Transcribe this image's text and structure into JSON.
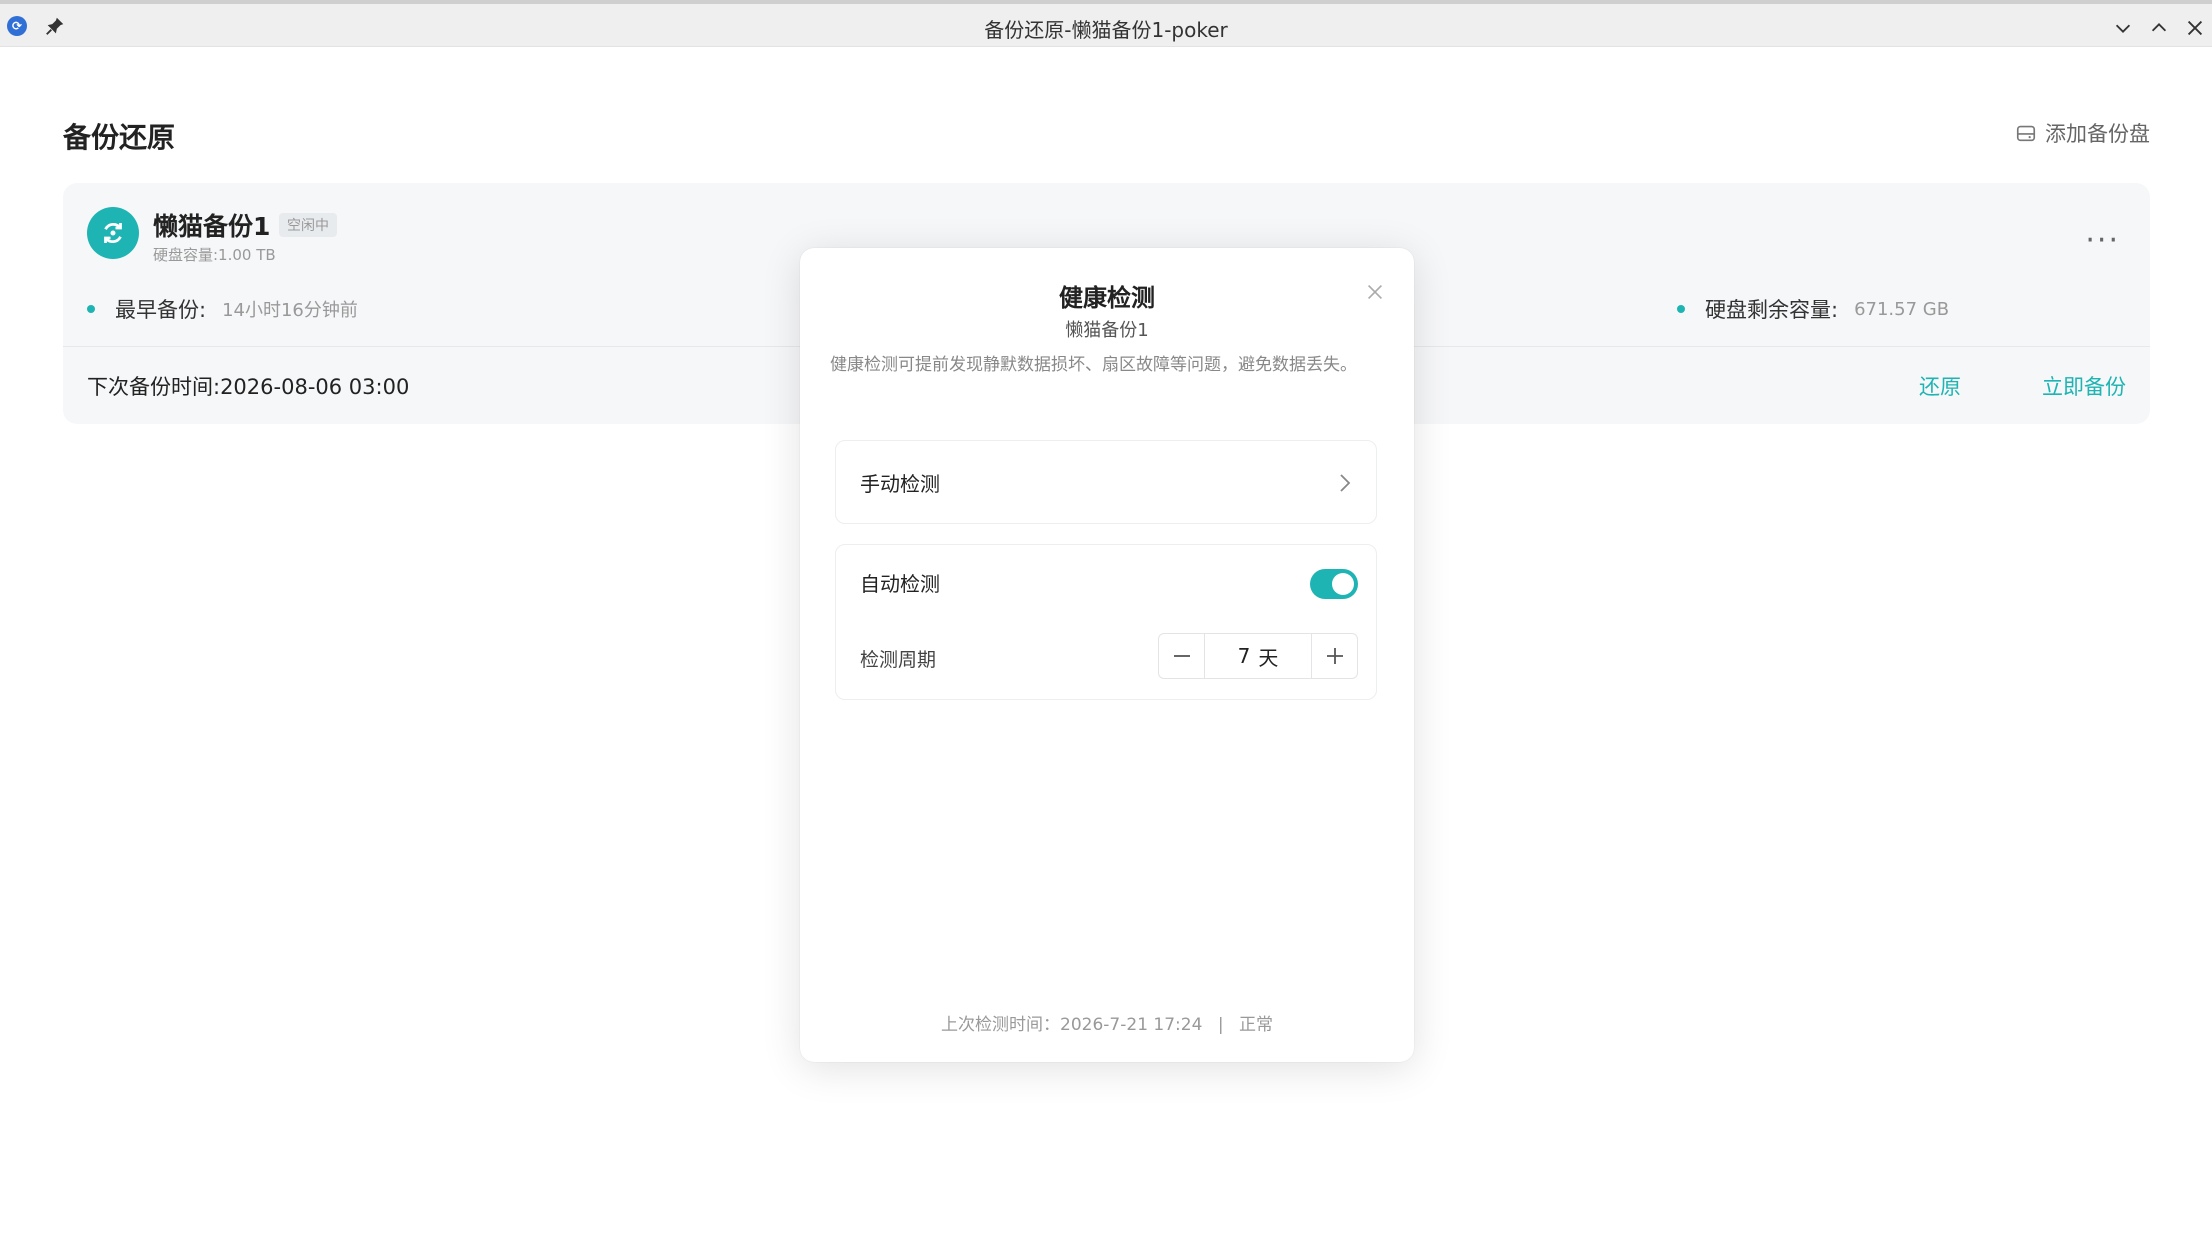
{
  "window": {
    "title": "备份还原-懒猫备份1-poker"
  },
  "page": {
    "title": "备份还原",
    "add_disk_label": "添加备份盘"
  },
  "card": {
    "name": "懒猫备份1",
    "status": "空闲中",
    "capacity": "硬盘容量:1.00 TB",
    "earliest_label": "最早备份:",
    "earliest_value": "14小时16分钟前",
    "remaining_label": "硬盘剩余容量:",
    "remaining_value": "671.57 GB",
    "next_backup": "下次备份时间:2026-08-06 03:00",
    "restore_label": "还原",
    "backup_now_label": "立即备份",
    "accent": "#1fb4b4"
  },
  "modal": {
    "title": "健康检测",
    "subtitle": "懒猫备份1",
    "description": "健康检测可提前发现静默数据损坏、扇区故障等问题，避免数据丢失。",
    "manual_label": "手动检测",
    "auto_label": "自动检测",
    "auto_enabled": true,
    "period_label": "检测周期",
    "period_value": "7",
    "period_unit": "天",
    "last_check_label": "上次检测时间：2026-7-21 17:24",
    "separator": "|",
    "last_check_status": "正常"
  }
}
